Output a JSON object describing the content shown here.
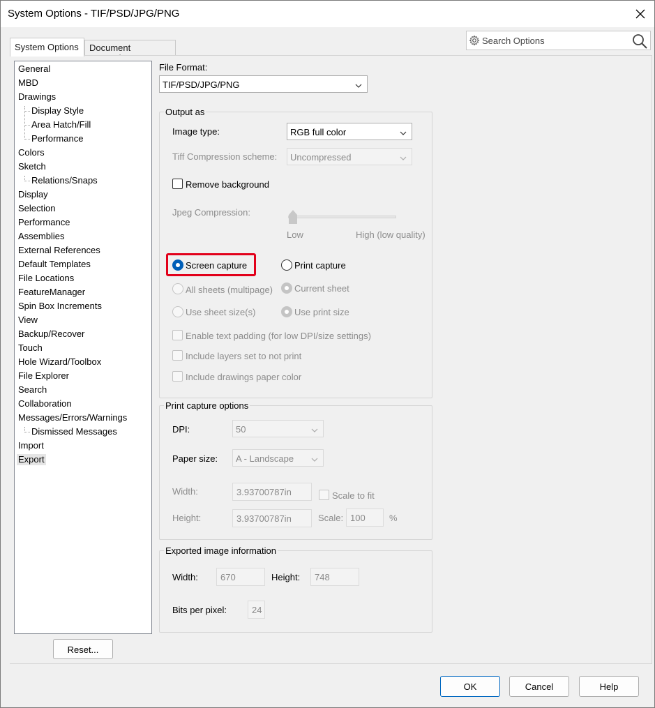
{
  "window": {
    "title": "System Options - TIF/PSD/JPG/PNG",
    "close_icon": "close-icon"
  },
  "search": {
    "placeholder": "Search Options",
    "gear_icon": "gear-icon",
    "search_icon": "search-icon"
  },
  "tabs": {
    "system_options": "System Options",
    "document_properties": "Document Properties"
  },
  "tree": {
    "items": [
      {
        "label": "General"
      },
      {
        "label": "MBD"
      },
      {
        "label": "Drawings"
      },
      {
        "label": "Display Style"
      },
      {
        "label": "Area Hatch/Fill"
      },
      {
        "label": "Performance"
      },
      {
        "label": "Colors"
      },
      {
        "label": "Sketch"
      },
      {
        "label": "Relations/Snaps"
      },
      {
        "label": "Display"
      },
      {
        "label": "Selection"
      },
      {
        "label": "Performance"
      },
      {
        "label": "Assemblies"
      },
      {
        "label": "External References"
      },
      {
        "label": "Default Templates"
      },
      {
        "label": "File Locations"
      },
      {
        "label": "FeatureManager"
      },
      {
        "label": "Spin Box Increments"
      },
      {
        "label": "View"
      },
      {
        "label": "Backup/Recover"
      },
      {
        "label": "Touch"
      },
      {
        "label": "Hole Wizard/Toolbox"
      },
      {
        "label": "File Explorer"
      },
      {
        "label": "Search"
      },
      {
        "label": "Collaboration"
      },
      {
        "label": "Messages/Errors/Warnings"
      },
      {
        "label": "Dismissed Messages"
      },
      {
        "label": "Import"
      },
      {
        "label": "Export"
      }
    ],
    "selected": "Export"
  },
  "reset_button": "Reset...",
  "file_format": {
    "label": "File Format:",
    "value": "TIF/PSD/JPG/PNG"
  },
  "output_as": {
    "group_title": "Output as",
    "image_type_label": "Image type:",
    "image_type_value": "RGB full color",
    "tiff_label": "Tiff Compression scheme:",
    "tiff_value": "Uncompressed",
    "remove_background": "Remove background",
    "jpeg_label": "Jpeg Compression:",
    "jpeg_low": "Low",
    "jpeg_high": "High (low quality)",
    "screen_capture": "Screen capture",
    "print_capture": "Print capture",
    "all_sheets": "All sheets (multipage)",
    "current_sheet": "Current sheet",
    "use_sheet_size": "Use sheet size(s)",
    "use_print_size": "Use print size",
    "enable_text_padding": "Enable text padding (for low DPI/size settings)",
    "include_layers": "Include layers set to not print",
    "include_paper_color": "Include drawings paper color"
  },
  "print_capture_options": {
    "group_title": "Print capture options",
    "dpi_label": "DPI:",
    "dpi_value": "50",
    "paper_size_label": "Paper size:",
    "paper_size_value": "A - Landscape",
    "width_label": "Width:",
    "width_value": "3.93700787in",
    "height_label": "Height:",
    "height_value": "3.93700787in",
    "scale_to_fit": "Scale to fit",
    "scale_label": "Scale:",
    "scale_value": "100",
    "scale_unit": "%"
  },
  "exported_info": {
    "group_title": "Exported image information",
    "width_label": "Width:",
    "width_value": "670",
    "height_label": "Height:",
    "height_value": "748",
    "bpp_label": "Bits per pixel:",
    "bpp_value": "24"
  },
  "footer": {
    "ok": "OK",
    "cancel": "Cancel",
    "help": "Help"
  },
  "colors": {
    "accent": "#005fb8",
    "highlight": "#e2001a"
  }
}
